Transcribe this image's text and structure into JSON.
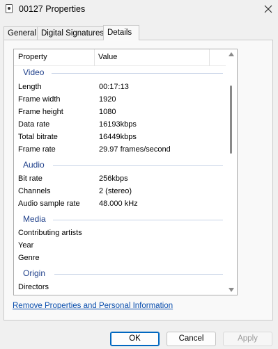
{
  "window": {
    "title": "00127 Properties"
  },
  "tabs": [
    "General",
    "Digital Signatures",
    "Details"
  ],
  "columns": {
    "property": "Property",
    "value": "Value"
  },
  "groups": {
    "video": "Video",
    "audio": "Audio",
    "media": "Media",
    "origin": "Origin"
  },
  "video": [
    {
      "k": "Length",
      "v": "00:17:13"
    },
    {
      "k": "Frame width",
      "v": "1920"
    },
    {
      "k": "Frame height",
      "v": "1080"
    },
    {
      "k": "Data rate",
      "v": "16193kbps"
    },
    {
      "k": "Total bitrate",
      "v": "16449kbps"
    },
    {
      "k": "Frame rate",
      "v": "29.97 frames/second"
    }
  ],
  "audio": [
    {
      "k": "Bit rate",
      "v": "256kbps"
    },
    {
      "k": "Channels",
      "v": "2 (stereo)"
    },
    {
      "k": "Audio sample rate",
      "v": "48.000 kHz"
    }
  ],
  "media": [
    {
      "k": "Contributing artists",
      "v": ""
    },
    {
      "k": "Year",
      "v": ""
    },
    {
      "k": "Genre",
      "v": ""
    }
  ],
  "origin": [
    {
      "k": "Directors",
      "v": ""
    }
  ],
  "links": {
    "remove": "Remove Properties and Personal Information"
  },
  "buttons": {
    "ok": "OK",
    "cancel": "Cancel",
    "apply": "Apply"
  }
}
